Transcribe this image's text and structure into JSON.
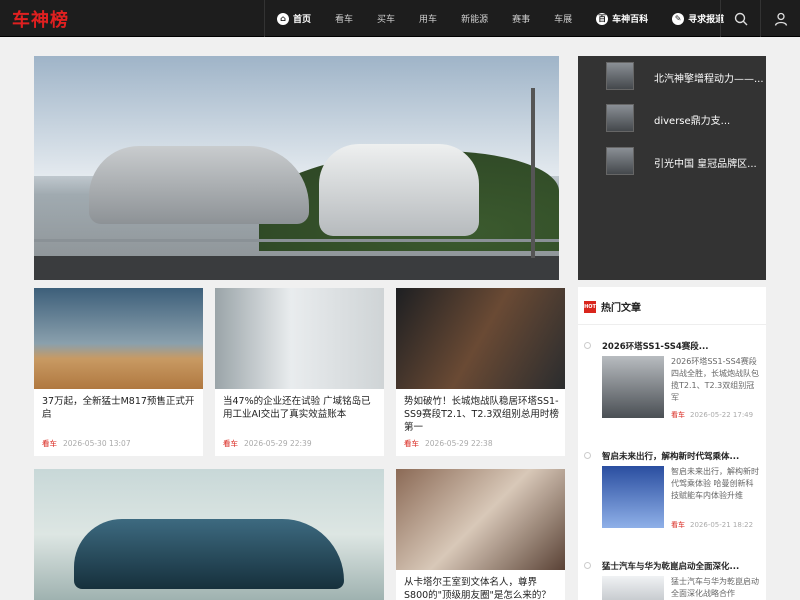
{
  "header": {
    "logo": "车神榜",
    "nav": [
      {
        "label": "首页",
        "icon": "home-icon",
        "bold": true
      },
      {
        "label": "看车"
      },
      {
        "label": "买车"
      },
      {
        "label": "用车"
      },
      {
        "label": "新能源"
      },
      {
        "label": "赛事"
      },
      {
        "label": "车展"
      },
      {
        "label": "车神百科",
        "icon": "wiki-icon",
        "bold": true
      },
      {
        "label": "寻求报道",
        "icon": "edit-icon",
        "bold": true
      }
    ],
    "search_icon": "search-icon",
    "user_icon": "user-icon"
  },
  "side_list": [
    {
      "text": "北汽神擎增程动力——..."
    },
    {
      "text": "diverse鼎力支..."
    },
    {
      "text": "引光中国 皇冠品牌区..."
    }
  ],
  "cards": [
    {
      "title": "37万起，全新猛士M817预售正式开启",
      "category": "看车",
      "date": "2026-05-30 13:07"
    },
    {
      "title": "当47%的企业还在试验 广域铭岛已用工业AI交出了真实效益账本",
      "category": "看车",
      "date": "2026-05-29 22:39"
    },
    {
      "title": "势如破竹！长城炮战队稳居环塔SS1-SS9赛段T2.1、T2.3双组别总用时榜第一",
      "category": "看车",
      "date": "2026-05-29 22:38"
    },
    {
      "title": "从卡塔尔王室到文体名人，尊界S800的\"顶级朋友圈\"是怎么来的？",
      "category": "",
      "date": ""
    }
  ],
  "hot": {
    "badge": "HOT",
    "label": "热门文章",
    "items": [
      {
        "title": "2026环塔SS1-SS4赛段...",
        "desc": "2026环塔SS1-SS4赛段四战全胜，长城炮战队包揽T2.1、T2.3双组别冠军",
        "category": "看车",
        "date": "2026-05-22 17:49"
      },
      {
        "title": "智启未来出行，解构新时代驾乘体...",
        "desc": "智启未来出行，解构新时代驾乘体验 哈曼创新科技赋能车内体验升维",
        "category": "看车",
        "date": "2026-05-21 18:22"
      },
      {
        "title": "猛士汽车与华为乾崑启动全面深化...",
        "desc": "猛士汽车与华为乾崑启动全面深化战略合作",
        "category": "",
        "date": ""
      }
    ]
  }
}
